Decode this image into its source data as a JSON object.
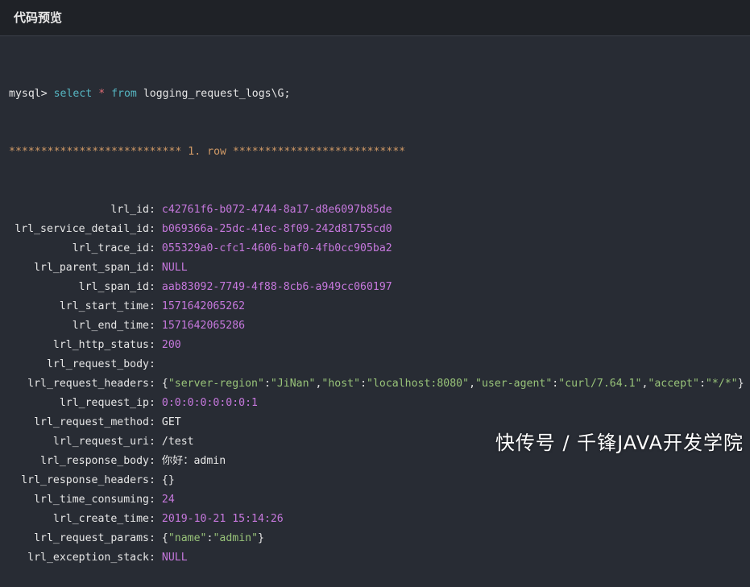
{
  "header": {
    "title": "代码预览"
  },
  "query": {
    "prompt": "mysql>",
    "kw_select": "select",
    "star": "*",
    "kw_from": "from",
    "table": "logging_request_logs\\G;"
  },
  "row_banner": "*************************** 1. row ***************************",
  "fields": [
    {
      "name": "lrl_id",
      "value": "c42761f6-b072-4744-8a17-d8e6097b85de",
      "style": "val"
    },
    {
      "name": "lrl_service_detail_id",
      "value": "b069366a-25dc-41ec-8f09-242d81755cd0",
      "style": "val"
    },
    {
      "name": "lrl_trace_id",
      "value": "055329a0-cfc1-4606-baf0-4fb0cc905ba2",
      "style": "val"
    },
    {
      "name": "lrl_parent_span_id",
      "value": "NULL",
      "style": "val"
    },
    {
      "name": "lrl_span_id",
      "value": "aab83092-7749-4f88-8cb6-a949cc060197",
      "style": "val"
    },
    {
      "name": "lrl_start_time",
      "value": "1571642065262",
      "style": "val"
    },
    {
      "name": "lrl_end_time",
      "value": "1571642065286",
      "style": "val"
    },
    {
      "name": "lrl_http_status",
      "value": "200",
      "style": "val"
    },
    {
      "name": "lrl_request_body",
      "value": "",
      "style": "val-plain"
    },
    {
      "name": "lrl_request_headers",
      "value": "{\"server-region\":\"JiNan\",\"host\":\"localhost:8080\",\"user-agent\":\"curl/7.64.1\",\"accept\":\"*/*\"}",
      "style": "json"
    },
    {
      "name": "lrl_request_ip",
      "value": "0:0:0:0:0:0:0:1",
      "style": "val"
    },
    {
      "name": "lrl_request_method",
      "value": "GET",
      "style": "val-plain"
    },
    {
      "name": "lrl_request_uri",
      "value": "/test",
      "style": "val-plain"
    },
    {
      "name": "lrl_response_body",
      "value": "你好：admin",
      "style": "val-plain"
    },
    {
      "name": "lrl_response_headers",
      "value": "{}",
      "style": "val-plain"
    },
    {
      "name": "lrl_time_consuming",
      "value": "24",
      "style": "val"
    },
    {
      "name": "lrl_create_time",
      "value": "2019-10-21 15:14:26",
      "style": "val"
    },
    {
      "name": "lrl_request_params",
      "value": "{\"name\":\"admin\"}",
      "style": "json"
    },
    {
      "name": "lrl_exception_stack",
      "value": "NULL",
      "style": "val"
    }
  ],
  "watermark": "快传号 / 千锋JAVA开发学院",
  "colors": {
    "background": "#282c34",
    "header_bg": "#1f2227",
    "keyword": "#56b6c2",
    "number_value": "#c678dd",
    "string": "#98c379",
    "banner": "#d19a66"
  }
}
